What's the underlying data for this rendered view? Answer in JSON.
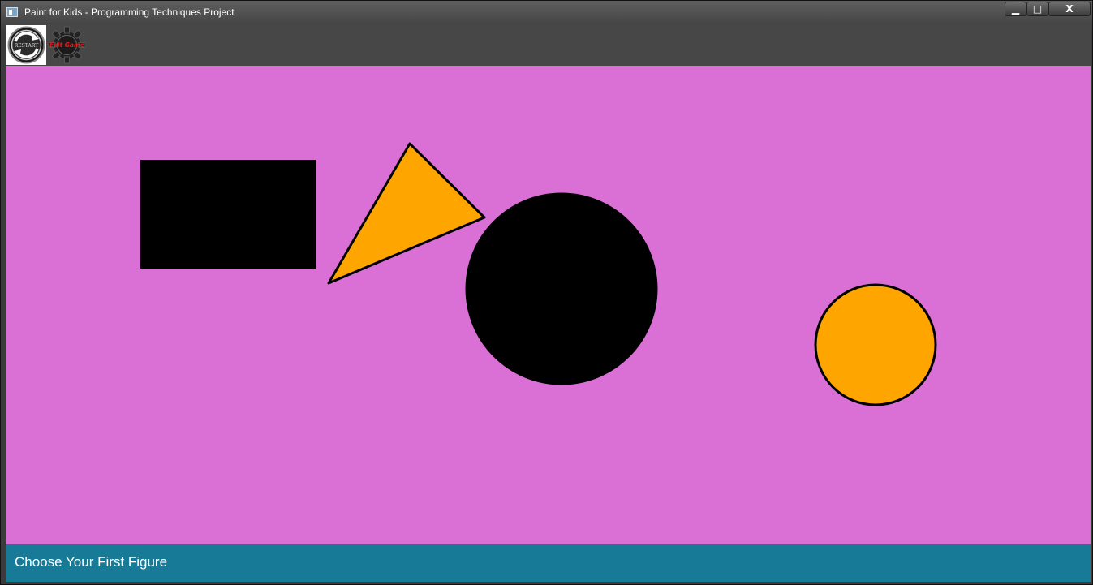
{
  "window": {
    "title": "Paint for Kids - Programming Techniques Project",
    "controls": {
      "minimize": "▁",
      "maximize": "□",
      "close": "X"
    }
  },
  "toolbar": {
    "items": [
      {
        "name": "restart",
        "icon": "restart-icon",
        "label": "RESTART"
      },
      {
        "name": "exit-game",
        "icon": "gear-icon",
        "label": "Exit Game"
      }
    ]
  },
  "canvas": {
    "background": "#da70d6",
    "figures": [
      {
        "type": "rectangle",
        "fill": "#000000"
      },
      {
        "type": "triangle",
        "fill": "#ffa500"
      },
      {
        "type": "circle",
        "fill": "#000000"
      },
      {
        "type": "circle",
        "fill": "#ffa500"
      }
    ]
  },
  "status": {
    "message": "Choose Your First Figure",
    "background": "#177a96"
  }
}
